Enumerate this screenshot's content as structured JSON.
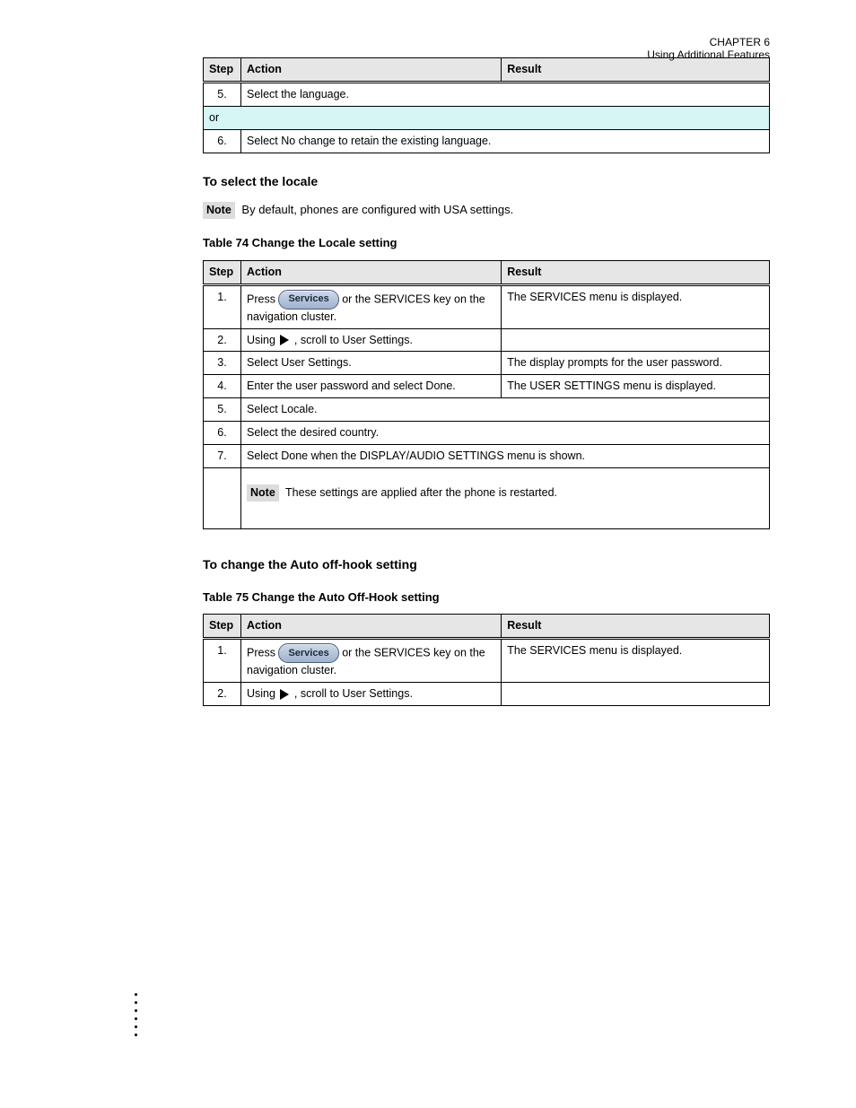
{
  "header": {
    "chapter": "CHAPTER 6",
    "title": "Using Additional Features"
  },
  "table1": {
    "headers": [
      "Step",
      "Action",
      "Result"
    ],
    "rows": [
      {
        "step": "5.",
        "action": "Select the language.",
        "result": ""
      },
      {
        "step": "",
        "full": "or"
      },
      {
        "step": "6.",
        "action": "Select No change to retain the existing language.",
        "result": ""
      }
    ]
  },
  "section_intro": {
    "heading": "To select the locale",
    "note": "By default, phones are configured with USA settings.",
    "caption": "Table 74  Change the Locale setting"
  },
  "table2": {
    "headers": [
      "Step",
      "Action",
      "Result"
    ],
    "rows": [
      {
        "step": "1.",
        "action_prefix": "Press ",
        "button": "Services",
        "action_suffix": " or the SERVICES key on the navigation cluster.",
        "result": "The SERVICES menu is displayed."
      },
      {
        "step": "2.",
        "action_prefix": "Using ",
        "nav_icon": true,
        "action_suffix": ", scroll to User Settings.",
        "result": ""
      },
      {
        "step": "3.",
        "action_prefix": "Select User Settings.",
        "result": "The display prompts for the user password."
      },
      {
        "step": "4.",
        "action_prefix": "Enter the user password and select Done.",
        "result": "The USER SETTINGS menu is displayed."
      },
      {
        "step": "5.",
        "action_prefix": "Select Locale.",
        "result": ""
      },
      {
        "step": "6.",
        "action_prefix": "Select the desired country.",
        "result": ""
      },
      {
        "step": "7.",
        "action_prefix": "Select Done when the DISPLAY/AUDIO SETTINGS menu is shown.",
        "result": ""
      },
      {
        "step": "",
        "note": "These settings are applied after the phone is restarted."
      }
    ]
  },
  "section_auto_off": {
    "heading": "To change the Auto off-hook setting",
    "caption": "Table 75  Change the Auto Off-Hook setting"
  },
  "table3": {
    "headers": [
      "Step",
      "Action",
      "Result"
    ],
    "rows": [
      {
        "step": "1.",
        "action_prefix": "Press ",
        "button": "Services",
        "action_suffix": " or the SERVICES key on the navigation cluster.",
        "result": "The SERVICES menu is displayed."
      },
      {
        "step": "2.",
        "action_prefix": "Using ",
        "nav_icon": true,
        "action_suffix": ", scroll to User Settings.",
        "result": ""
      }
    ]
  }
}
